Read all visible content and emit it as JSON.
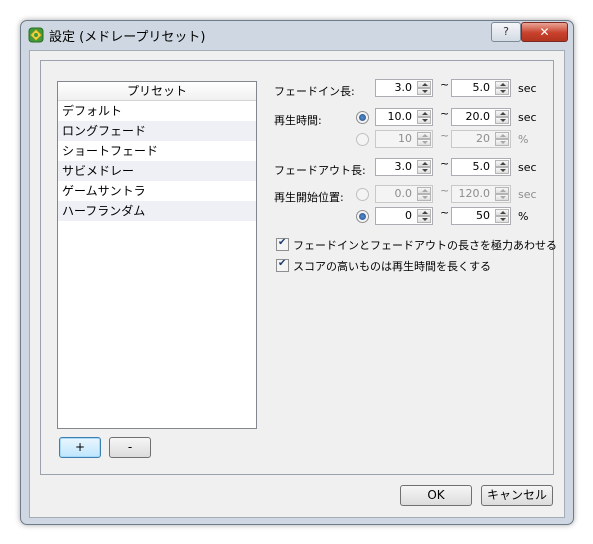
{
  "window": {
    "title": "設定 (メドレープリセット)",
    "help_label": "?",
    "close_label": "✕"
  },
  "preset_list": {
    "header": "プリセット",
    "items": [
      "デフォルト",
      "ロングフェード",
      "ショートフェード",
      "サビメドレー",
      "ゲームサントラ",
      "ハーフランダム"
    ]
  },
  "buttons": {
    "add": "+",
    "remove": "-",
    "ok": "OK",
    "cancel": "キャンセル"
  },
  "fade_in": {
    "label": "フェードイン長:",
    "min": "3.0",
    "max": "5.0",
    "unit": "sec"
  },
  "play_time": {
    "label": "再生時間:",
    "sec_row": {
      "min": "10.0",
      "max": "20.0",
      "unit": "sec",
      "selected": true
    },
    "pct_row": {
      "min": "10",
      "max": "20",
      "unit": "%",
      "selected": false
    }
  },
  "fade_out": {
    "label": "フェードアウト長:",
    "min": "3.0",
    "max": "5.0",
    "unit": "sec"
  },
  "start_pos": {
    "label": "再生開始位置:",
    "sec_row": {
      "min": "0.0",
      "max": "120.0",
      "unit": "sec",
      "selected": false
    },
    "pct_row": {
      "min": "0",
      "max": "50",
      "unit": "%",
      "selected": true
    }
  },
  "range_sep": "~",
  "options": {
    "match_fade": {
      "label": "フェードインとフェードアウトの長さを極力あわせる",
      "checked": true
    },
    "longer_for_high_score": {
      "label": "スコアの高いものは再生時間を長くする",
      "checked": true
    }
  }
}
